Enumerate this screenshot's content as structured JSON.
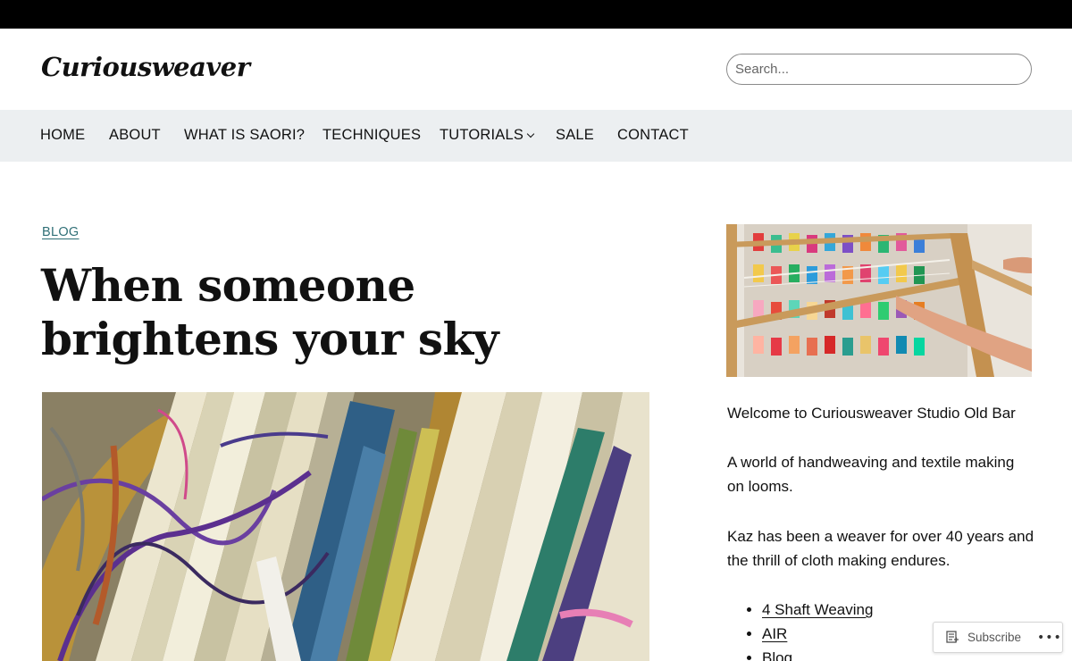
{
  "site": {
    "title": "Curiousweaver"
  },
  "search": {
    "placeholder": "Search..."
  },
  "nav": {
    "items": [
      {
        "label": "HOME"
      },
      {
        "label": "ABOUT"
      },
      {
        "label": "WHAT IS SAORI?"
      },
      {
        "label": "TECHNIQUES"
      },
      {
        "label": "TUTORIALS",
        "has_dropdown": true
      },
      {
        "label": "SALE"
      },
      {
        "label": "CONTACT"
      }
    ]
  },
  "post": {
    "category": "BLOG",
    "title": "When someone brightens your sky"
  },
  "sidebar": {
    "welcome": "Welcome to Curiousweaver Studio Old Bar",
    "intro": "A world of handweaving and textile making on looms.",
    "bio": "Kaz has been a weaver for over 40 years and the thrill of cloth making endures.",
    "links": [
      "4 Shaft Weaving",
      "AIR",
      "Blog"
    ]
  },
  "subscribe": {
    "label": "Subscribe",
    "more_icon": "ellipsis-icon"
  },
  "colors": {
    "topbar": "#000000",
    "nav_background": "#eceff1",
    "category_link": "#2f6f76"
  }
}
